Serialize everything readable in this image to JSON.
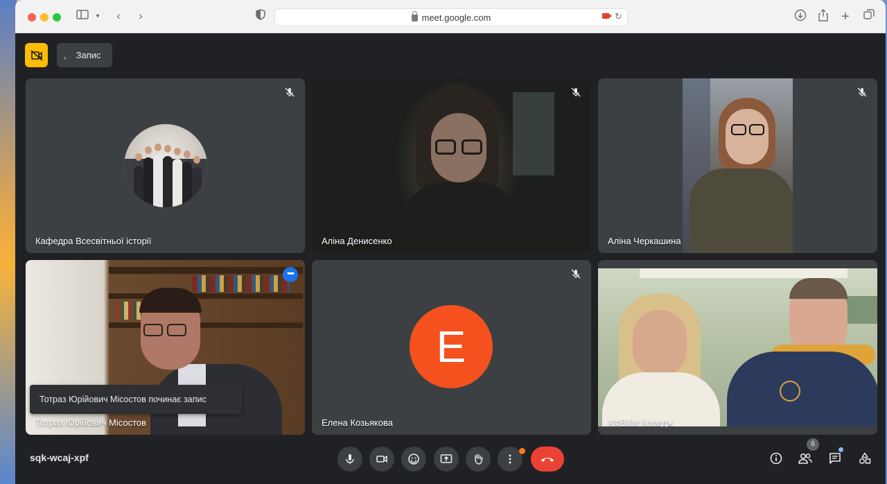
{
  "browser": {
    "url": "meet.google.com"
  },
  "meet": {
    "recording_chip_label": "Запис",
    "recording_chip_prefix": ",",
    "meeting_code": "sqk-wcaj-xpf",
    "participant_count": "6",
    "toast_text": "Тотраз Юрійович Місостов починає запис"
  },
  "tiles": [
    {
      "name": "Кафедра Всесвітньої історії",
      "muted": true,
      "type": "photo-avatar"
    },
    {
      "name": "Аліна Денисенко",
      "muted": true,
      "type": "video"
    },
    {
      "name": "Аліна Черкашина",
      "muted": true,
      "type": "video"
    },
    {
      "name": "Тотраз Юрійович Місостов",
      "muted": false,
      "type": "video",
      "active": true
    },
    {
      "name": "Елена Козьякова",
      "muted": true,
      "type": "letter-avatar",
      "initial": "E",
      "avatar_color": "#f4511e"
    },
    {
      "name": "ХФВКМ Коледж",
      "muted": false,
      "type": "video"
    }
  ],
  "colors": {
    "meet_bg": "#202124",
    "tile_bg": "#3c4043",
    "end_call": "#ea4335",
    "recording_badge": "#fbbc04",
    "active_outline": "#8ab4f8"
  }
}
